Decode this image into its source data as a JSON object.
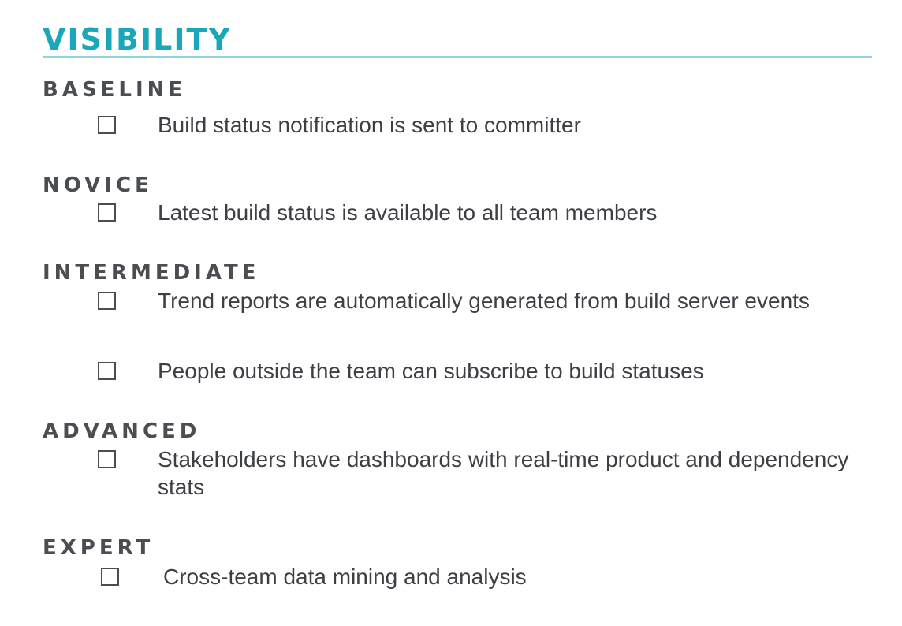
{
  "title": "VISIBILITY",
  "levels": [
    {
      "name": "BASELINE",
      "items": [
        "Build status notification is sent to committer"
      ]
    },
    {
      "name": "NOVICE",
      "items": [
        "Latest build status is available to all team members"
      ]
    },
    {
      "name": "INTERMEDIATE",
      "items": [
        "Trend reports are automatically generated from build server events",
        "People outside the team can subscribe to build statuses"
      ]
    },
    {
      "name": "ADVANCED",
      "items": [
        "Stakeholders have dashboards with real-time product and dependency stats"
      ]
    },
    {
      "name": "EXPERT",
      "items": [
        "Cross-team data mining and analysis"
      ]
    }
  ],
  "colors": {
    "title": "#1aa7b9",
    "rule": "#8fd6df",
    "heading": "#4a4d52",
    "text": "#3c3f44"
  }
}
